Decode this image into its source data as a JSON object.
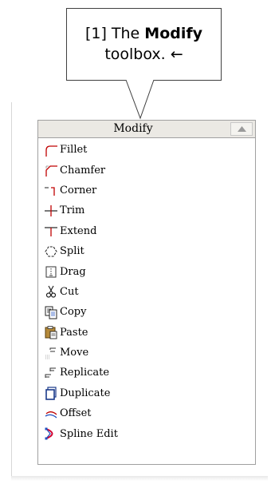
{
  "callout": {
    "prefix": "[1] The",
    "bold": "Modify",
    "suffix": "toolbox. ←"
  },
  "panel": {
    "title": "Modify",
    "collapse_icon": "triangle-up-icon"
  },
  "items": [
    {
      "label": "Fillet",
      "icon": "fillet-icon"
    },
    {
      "label": "Chamfer",
      "icon": "chamfer-icon"
    },
    {
      "label": "Corner",
      "icon": "corner-icon"
    },
    {
      "label": "Trim",
      "icon": "trim-icon"
    },
    {
      "label": "Extend",
      "icon": "extend-icon"
    },
    {
      "label": "Split",
      "icon": "split-icon"
    },
    {
      "label": "Drag",
      "icon": "drag-icon"
    },
    {
      "label": "Cut",
      "icon": "scissors-icon"
    },
    {
      "label": "Copy",
      "icon": "copy-icon"
    },
    {
      "label": "Paste",
      "icon": "paste-icon"
    },
    {
      "label": "Move",
      "icon": "move-icon"
    },
    {
      "label": "Replicate",
      "icon": "replicate-icon"
    },
    {
      "label": "Duplicate",
      "icon": "duplicate-icon"
    },
    {
      "label": "Offset",
      "icon": "offset-icon"
    },
    {
      "label": "Spline Edit",
      "icon": "spline-edit-icon"
    }
  ]
}
